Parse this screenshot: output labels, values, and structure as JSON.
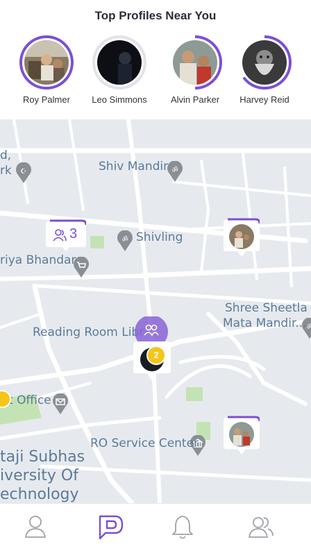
{
  "header": {
    "title": "Top Profiles Near You",
    "profiles": [
      {
        "name": "Roy Palmer",
        "ring_color": "#7b4fd6",
        "ring_fraction": 1.0
      },
      {
        "name": "Leo Simmons",
        "ring_color": "#e2e2e8",
        "ring_fraction": 1.0
      },
      {
        "name": "Alvin Parker",
        "ring_color": "#7b4fd6",
        "ring_fraction": 0.5
      },
      {
        "name": "Harvey Reid",
        "ring_color": "#7b4fd6",
        "ring_fraction": 0.65
      }
    ]
  },
  "map": {
    "places": {
      "shiv_mandir": "Shiv Mandir",
      "shivling": "Shivling",
      "bhandar": "riya Bhandar",
      "sheetla_1": "Shree Sheetla",
      "sheetla_2": "Mata Mandir...",
      "reading_room": "Reading Room Libr",
      "post_office": "t Office",
      "ro_service": "RO Service Center",
      "subhas_1": "taji Subhas",
      "subhas_2": "iversity Of",
      "subhas_3": "echnology",
      "edge_1": "d,",
      "edge_2": "rk"
    },
    "group_marker": {
      "count": "3"
    },
    "cluster_badge": "2"
  },
  "colors": {
    "accent": "#7b4fd6",
    "badge": "#f5c518",
    "map_bg": "#e6eaee",
    "road": "#ffffff",
    "park": "#c4e3b4",
    "label": "#5b7a99"
  },
  "tabs": [
    {
      "icon": "user-icon",
      "active": false
    },
    {
      "icon": "chat-icon",
      "active": true
    },
    {
      "icon": "bell-icon",
      "active": false
    },
    {
      "icon": "users-icon",
      "active": false
    }
  ]
}
